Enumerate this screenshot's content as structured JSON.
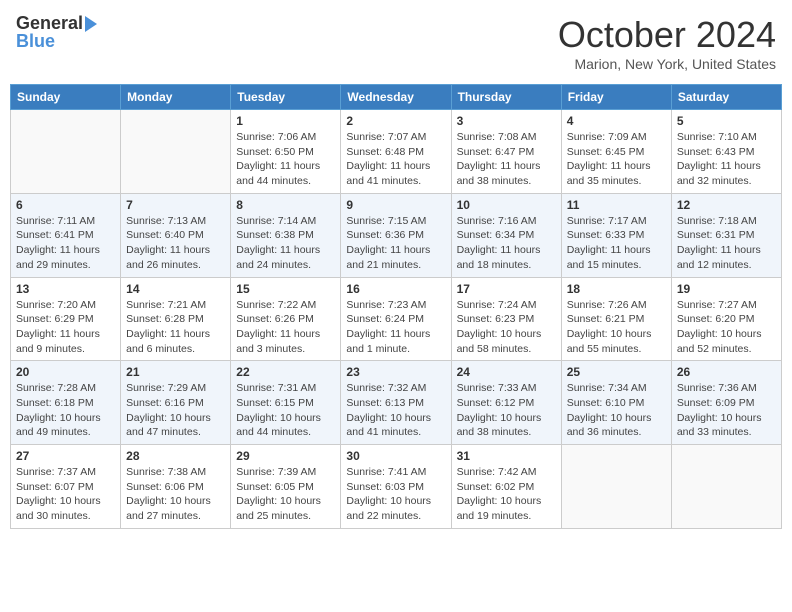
{
  "header": {
    "logo_line1": "General",
    "logo_line2": "Blue",
    "month": "October 2024",
    "location": "Marion, New York, United States"
  },
  "weekdays": [
    "Sunday",
    "Monday",
    "Tuesday",
    "Wednesday",
    "Thursday",
    "Friday",
    "Saturday"
  ],
  "weeks": [
    [
      {
        "day": "",
        "sunrise": "",
        "sunset": "",
        "daylight": ""
      },
      {
        "day": "",
        "sunrise": "",
        "sunset": "",
        "daylight": ""
      },
      {
        "day": "1",
        "sunrise": "Sunrise: 7:06 AM",
        "sunset": "Sunset: 6:50 PM",
        "daylight": "Daylight: 11 hours and 44 minutes."
      },
      {
        "day": "2",
        "sunrise": "Sunrise: 7:07 AM",
        "sunset": "Sunset: 6:48 PM",
        "daylight": "Daylight: 11 hours and 41 minutes."
      },
      {
        "day": "3",
        "sunrise": "Sunrise: 7:08 AM",
        "sunset": "Sunset: 6:47 PM",
        "daylight": "Daylight: 11 hours and 38 minutes."
      },
      {
        "day": "4",
        "sunrise": "Sunrise: 7:09 AM",
        "sunset": "Sunset: 6:45 PM",
        "daylight": "Daylight: 11 hours and 35 minutes."
      },
      {
        "day": "5",
        "sunrise": "Sunrise: 7:10 AM",
        "sunset": "Sunset: 6:43 PM",
        "daylight": "Daylight: 11 hours and 32 minutes."
      }
    ],
    [
      {
        "day": "6",
        "sunrise": "Sunrise: 7:11 AM",
        "sunset": "Sunset: 6:41 PM",
        "daylight": "Daylight: 11 hours and 29 minutes."
      },
      {
        "day": "7",
        "sunrise": "Sunrise: 7:13 AM",
        "sunset": "Sunset: 6:40 PM",
        "daylight": "Daylight: 11 hours and 26 minutes."
      },
      {
        "day": "8",
        "sunrise": "Sunrise: 7:14 AM",
        "sunset": "Sunset: 6:38 PM",
        "daylight": "Daylight: 11 hours and 24 minutes."
      },
      {
        "day": "9",
        "sunrise": "Sunrise: 7:15 AM",
        "sunset": "Sunset: 6:36 PM",
        "daylight": "Daylight: 11 hours and 21 minutes."
      },
      {
        "day": "10",
        "sunrise": "Sunrise: 7:16 AM",
        "sunset": "Sunset: 6:34 PM",
        "daylight": "Daylight: 11 hours and 18 minutes."
      },
      {
        "day": "11",
        "sunrise": "Sunrise: 7:17 AM",
        "sunset": "Sunset: 6:33 PM",
        "daylight": "Daylight: 11 hours and 15 minutes."
      },
      {
        "day": "12",
        "sunrise": "Sunrise: 7:18 AM",
        "sunset": "Sunset: 6:31 PM",
        "daylight": "Daylight: 11 hours and 12 minutes."
      }
    ],
    [
      {
        "day": "13",
        "sunrise": "Sunrise: 7:20 AM",
        "sunset": "Sunset: 6:29 PM",
        "daylight": "Daylight: 11 hours and 9 minutes."
      },
      {
        "day": "14",
        "sunrise": "Sunrise: 7:21 AM",
        "sunset": "Sunset: 6:28 PM",
        "daylight": "Daylight: 11 hours and 6 minutes."
      },
      {
        "day": "15",
        "sunrise": "Sunrise: 7:22 AM",
        "sunset": "Sunset: 6:26 PM",
        "daylight": "Daylight: 11 hours and 3 minutes."
      },
      {
        "day": "16",
        "sunrise": "Sunrise: 7:23 AM",
        "sunset": "Sunset: 6:24 PM",
        "daylight": "Daylight: 11 hours and 1 minute."
      },
      {
        "day": "17",
        "sunrise": "Sunrise: 7:24 AM",
        "sunset": "Sunset: 6:23 PM",
        "daylight": "Daylight: 10 hours and 58 minutes."
      },
      {
        "day": "18",
        "sunrise": "Sunrise: 7:26 AM",
        "sunset": "Sunset: 6:21 PM",
        "daylight": "Daylight: 10 hours and 55 minutes."
      },
      {
        "day": "19",
        "sunrise": "Sunrise: 7:27 AM",
        "sunset": "Sunset: 6:20 PM",
        "daylight": "Daylight: 10 hours and 52 minutes."
      }
    ],
    [
      {
        "day": "20",
        "sunrise": "Sunrise: 7:28 AM",
        "sunset": "Sunset: 6:18 PM",
        "daylight": "Daylight: 10 hours and 49 minutes."
      },
      {
        "day": "21",
        "sunrise": "Sunrise: 7:29 AM",
        "sunset": "Sunset: 6:16 PM",
        "daylight": "Daylight: 10 hours and 47 minutes."
      },
      {
        "day": "22",
        "sunrise": "Sunrise: 7:31 AM",
        "sunset": "Sunset: 6:15 PM",
        "daylight": "Daylight: 10 hours and 44 minutes."
      },
      {
        "day": "23",
        "sunrise": "Sunrise: 7:32 AM",
        "sunset": "Sunset: 6:13 PM",
        "daylight": "Daylight: 10 hours and 41 minutes."
      },
      {
        "day": "24",
        "sunrise": "Sunrise: 7:33 AM",
        "sunset": "Sunset: 6:12 PM",
        "daylight": "Daylight: 10 hours and 38 minutes."
      },
      {
        "day": "25",
        "sunrise": "Sunrise: 7:34 AM",
        "sunset": "Sunset: 6:10 PM",
        "daylight": "Daylight: 10 hours and 36 minutes."
      },
      {
        "day": "26",
        "sunrise": "Sunrise: 7:36 AM",
        "sunset": "Sunset: 6:09 PM",
        "daylight": "Daylight: 10 hours and 33 minutes."
      }
    ],
    [
      {
        "day": "27",
        "sunrise": "Sunrise: 7:37 AM",
        "sunset": "Sunset: 6:07 PM",
        "daylight": "Daylight: 10 hours and 30 minutes."
      },
      {
        "day": "28",
        "sunrise": "Sunrise: 7:38 AM",
        "sunset": "Sunset: 6:06 PM",
        "daylight": "Daylight: 10 hours and 27 minutes."
      },
      {
        "day": "29",
        "sunrise": "Sunrise: 7:39 AM",
        "sunset": "Sunset: 6:05 PM",
        "daylight": "Daylight: 10 hours and 25 minutes."
      },
      {
        "day": "30",
        "sunrise": "Sunrise: 7:41 AM",
        "sunset": "Sunset: 6:03 PM",
        "daylight": "Daylight: 10 hours and 22 minutes."
      },
      {
        "day": "31",
        "sunrise": "Sunrise: 7:42 AM",
        "sunset": "Sunset: 6:02 PM",
        "daylight": "Daylight: 10 hours and 19 minutes."
      },
      {
        "day": "",
        "sunrise": "",
        "sunset": "",
        "daylight": ""
      },
      {
        "day": "",
        "sunrise": "",
        "sunset": "",
        "daylight": ""
      }
    ]
  ]
}
